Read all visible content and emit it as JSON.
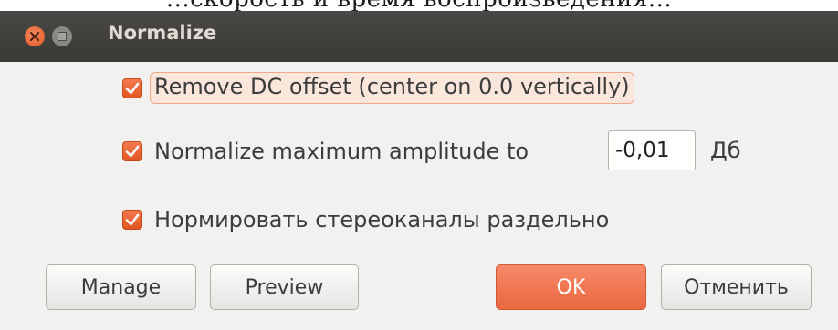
{
  "window": {
    "title": "Normalize",
    "top_partial_text": "...скорость и время воспроизведения...",
    "accent": "#e9683f",
    "titlebar_color": "#3c3b37"
  },
  "options": [
    {
      "label": "Remove DC offset (center on 0.0 vertically)",
      "checked": true,
      "focused": true
    },
    {
      "label": "Normalize maximum amplitude to",
      "checked": true
    },
    {
      "label": "Нормировать стереоканалы раздельно",
      "checked": true
    }
  ],
  "amplitude": {
    "value": "-0,01",
    "unit": "Дб"
  },
  "buttons": {
    "manage": "Manage",
    "preview": "Preview",
    "ok": "OK",
    "cancel": "Отменить"
  }
}
